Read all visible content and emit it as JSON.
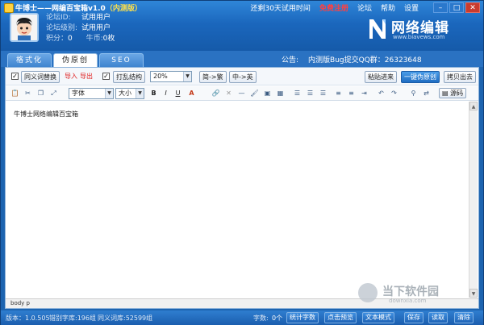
{
  "titlebar": {
    "title_main": "牛博士——网编百宝箱v1.0",
    "title_edition": "（内测版）"
  },
  "user": {
    "forum_id_label": "论坛ID:",
    "forum_id_value": "试用用户",
    "forum_level_label": "论坛级别:",
    "forum_level_value": "试用用户",
    "points_label": "积分：",
    "points_value": "0",
    "coins_label": "牛币:",
    "coins_value": "0枚"
  },
  "top_menu": {
    "trial_text": "还剩30天试用时间",
    "register": "免费注册",
    "forum": "论坛",
    "help": "帮助",
    "settings": "设置"
  },
  "window_controls": {
    "minimize": "–",
    "maximize": "□",
    "close": "✕"
  },
  "logo": {
    "text": "网络编辑",
    "url": "www.biavews.com"
  },
  "tabs": [
    {
      "label": "格式化"
    },
    {
      "label": "伪原创"
    },
    {
      "label": "SEO"
    }
  ],
  "announce": {
    "label": "公告:",
    "text": "内测版Bug提交QQ群：26323648"
  },
  "toolbar1": {
    "synonym_label": "同义词替换",
    "import_label": "导入",
    "export_label": "导出",
    "shuffle_label": "打乱结构",
    "percent_value": "20%",
    "trad_to_simp": "简->繁",
    "cn_to_en": "中->英",
    "paste_in": "粘贴进来",
    "one_click": "一键伪原创",
    "copy_out": "拷贝出去"
  },
  "toolbar2": {
    "font_value": "字体",
    "size_value": "大小",
    "source_label": "源码",
    "icons": [
      "paste-icon",
      "cut-icon",
      "copy-icon",
      "fullscreen-icon",
      "bold-icon",
      "italic-icon",
      "underline-icon",
      "font-color-icon",
      "link-icon",
      "unlink-icon",
      "hr-icon",
      "brush-icon",
      "image-icon",
      "table-icon",
      "align-left-icon",
      "align-center-icon",
      "align-right-icon",
      "ordered-list-icon",
      "unordered-list-icon",
      "indent-icon",
      "undo-icon",
      "redo-icon",
      "find-icon",
      "replace-icon",
      "source-icon"
    ]
  },
  "editor": {
    "content": "牛博士网络编辑百宝箱"
  },
  "statusline": {
    "path": "body  p"
  },
  "watermark": {
    "text": "当下软件园",
    "url": "downxia.com"
  },
  "footer": {
    "version": "版本：1.0.505",
    "typo_dict": "错别字库:196组",
    "synonym_dict": "同义词库:52599组",
    "char_count_label": "字数:",
    "char_count_value": "0个",
    "stats_button": "统计字数",
    "preview_button": "点击预览",
    "text_mode_button": "文本模式",
    "save_button": "保存",
    "read_button": "读取",
    "clear_button": "清除"
  }
}
